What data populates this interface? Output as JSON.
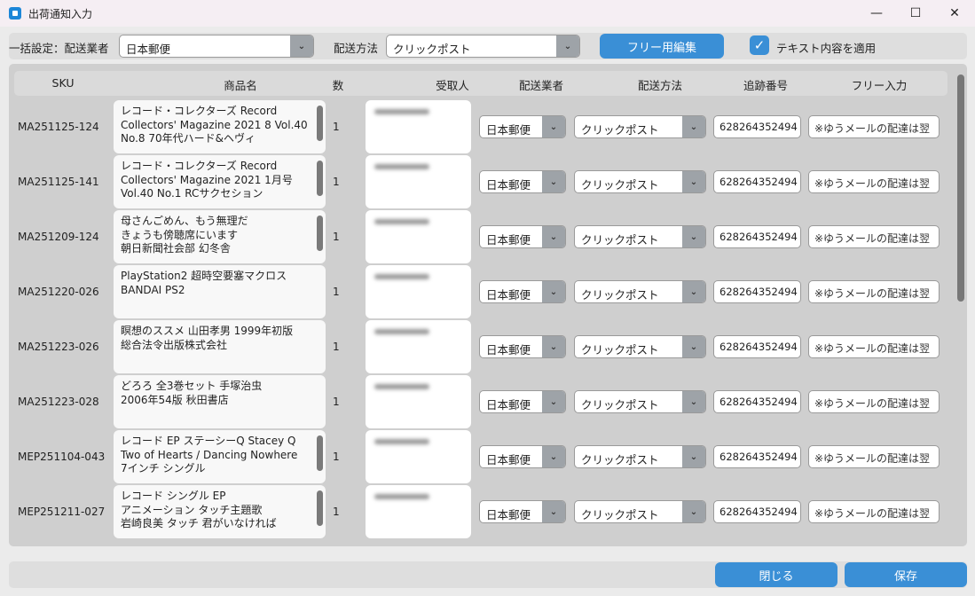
{
  "window": {
    "title": "出荷通知入力",
    "minimize": "—",
    "maximize": "☐",
    "close": "✕"
  },
  "toolbar": {
    "carrier_label": "一括設定：配送業者",
    "carrier_value": "日本郵便",
    "method_label": "配送方法",
    "method_value": "クリックポスト",
    "free_edit_button": "フリー用編集",
    "apply_text_label": "テキスト内容を適用",
    "apply_text_checked": true
  },
  "table": {
    "headers": [
      "SKU",
      "商品名",
      "数",
      "受取人",
      "配送業者",
      "配送方法",
      "追跡番号",
      "フリー入力"
    ],
    "rows": [
      {
        "sku": "MA251125-124",
        "name": "レコード・コレクターズ Record\nCollectors' Magazine 2021 8 Vol.40\nNo.8 70年代ハード&ヘヴィ",
        "qty": "1",
        "carrier": "日本郵便",
        "method": "クリックポスト",
        "tracking": "628264352494",
        "free": "※ゆうメールの配達は翌",
        "scroll": true
      },
      {
        "sku": "MA251125-141",
        "name": "レコード・コレクターズ Record\nCollectors' Magazine 2021 1月号\nVol.40 No.1 RCサクセション",
        "qty": "1",
        "carrier": "日本郵便",
        "method": "クリックポスト",
        "tracking": "628264352494",
        "free": "※ゆうメールの配達は翌",
        "scroll": true
      },
      {
        "sku": "MA251209-124",
        "name": "母さんごめん、もう無理だ\nきょうも傍聴席にいます\n朝日新聞社会部 幻冬舎",
        "qty": "1",
        "carrier": "日本郵便",
        "method": "クリックポスト",
        "tracking": "628264352494",
        "free": "※ゆうメールの配達は翌",
        "scroll": true
      },
      {
        "sku": "MA251220-026",
        "name": "PlayStation2 超時空要塞マクロス\nBANDAI PS2",
        "qty": "1",
        "carrier": "日本郵便",
        "method": "クリックポスト",
        "tracking": "628264352494",
        "free": "※ゆうメールの配達は翌",
        "scroll": false
      },
      {
        "sku": "MA251223-026",
        "name": "瞑想のススメ 山田孝男 1999年初版\n総合法令出版株式会社",
        "qty": "1",
        "carrier": "日本郵便",
        "method": "クリックポスト",
        "tracking": "628264352494",
        "free": "※ゆうメールの配達は翌",
        "scroll": false
      },
      {
        "sku": "MA251223-028",
        "name": "どろろ 全3巻セット 手塚治虫\n2006年54版 秋田書店",
        "qty": "1",
        "carrier": "日本郵便",
        "method": "クリックポスト",
        "tracking": "628264352494",
        "free": "※ゆうメールの配達は翌",
        "scroll": false
      },
      {
        "sku": "MEP251104-043",
        "name": "レコード EP ステーシーQ Stacey Q\nTwo of Hearts / Dancing Nowhere\n7インチ シングル",
        "qty": "1",
        "carrier": "日本郵便",
        "method": "クリックポスト",
        "tracking": "628264352494",
        "free": "※ゆうメールの配達は翌",
        "scroll": true
      },
      {
        "sku": "MEP251211-027",
        "name": "レコード シングル EP\nアニメーション タッチ主題歌\n岩崎良美 タッチ 君がいなければ",
        "qty": "1",
        "carrier": "日本郵便",
        "method": "クリックポスト",
        "tracking": "628264352494",
        "free": "※ゆうメールの配達は翌",
        "scroll": true
      }
    ]
  },
  "footer": {
    "close_button": "閉じる",
    "save_button": "保存"
  }
}
